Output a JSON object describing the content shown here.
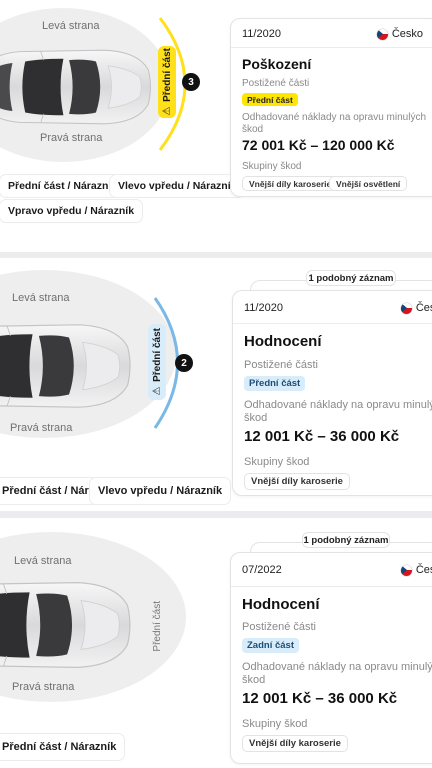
{
  "records": [
    {
      "diagram": {
        "left_side": "Levá strana",
        "right_side": "Pravá strana",
        "front_part": "Přední část",
        "badge_number": "3",
        "accent_color": "#ffe01a"
      },
      "damage_chips": [
        "Přední část / Nárazník",
        "Vlevo vpředu / Nárazník",
        "Vpravo vpředu / Nárazník"
      ],
      "card": {
        "date": "11/2020",
        "country": "Česko",
        "title": "Poškození",
        "affected_label": "Postižené části",
        "affected_tag": "Přední část",
        "cost_label": "Odhadované náklady na opravu minulých škod",
        "cost_range": "72 001 Kč – 120 000 Kč",
        "groups_label": "Skupiny škod",
        "groups": [
          "Vnější díly karoserie",
          "Vnější osvětlení"
        ]
      }
    },
    {
      "similar_records": "1 podobný záznam",
      "diagram": {
        "left_side": "Levá strana",
        "right_side": "Pravá strana",
        "front_part": "Přední část",
        "badge_number": "2",
        "accent_color": "#7ab8e6"
      },
      "damage_chips": [
        "Přední část / Nárazník",
        "Vlevo vpředu / Nárazník"
      ],
      "card": {
        "date": "11/2020",
        "country": "Česko",
        "title": "Hodnocení",
        "affected_label": "Postižené části",
        "affected_tag": "Přední část",
        "cost_label": "Odhadované náklady na opravu minulých škod",
        "cost_range": "12 001 Kč – 36 000 Kč",
        "groups_label": "Skupiny škod",
        "groups": [
          "Vnější díly karoserie"
        ]
      }
    },
    {
      "similar_records": "1 podobný záznam",
      "diagram": {
        "left_side": "Levá strana",
        "right_side": "Pravá strana",
        "front_part": "Přední část"
      },
      "damage_chips": [
        "Přední část / Nárazník"
      ],
      "card": {
        "date": "07/2022",
        "country": "Česko",
        "title": "Hodnocení",
        "affected_label": "Postižené části",
        "affected_tag": "Zadní část",
        "cost_label": "Odhadované náklady na opravu minulých škod",
        "cost_range": "12 001 Kč – 36 000 Kč",
        "groups_label": "Skupiny škod",
        "groups": [
          "Vnější díly karoserie"
        ]
      }
    }
  ],
  "icons": {
    "warning": "warning-triangle-icon",
    "flag": "czech-flag-icon",
    "car": "car-top-view-icon"
  }
}
